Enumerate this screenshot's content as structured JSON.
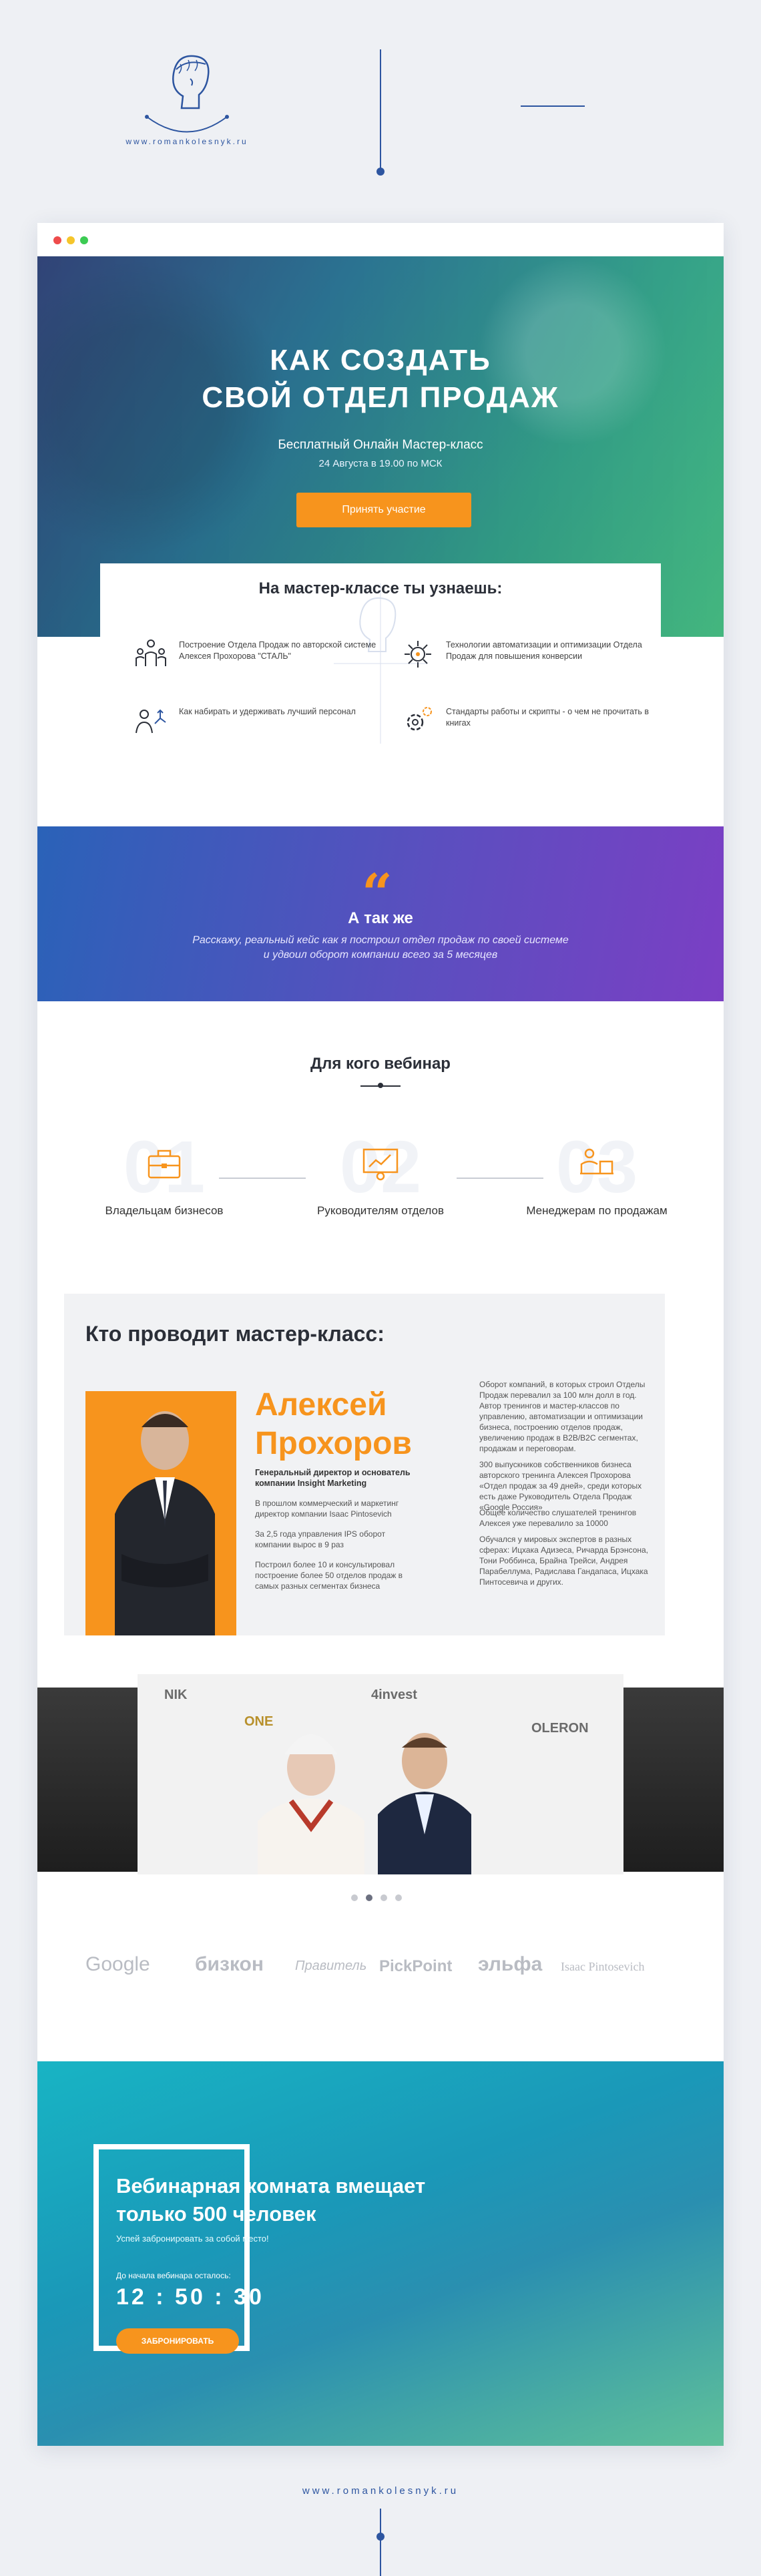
{
  "brand": {
    "url": "www.romankolesnyk.ru",
    "colors": {
      "accent": "#2d55a0",
      "orange": "#f7941d"
    }
  },
  "window": {
    "dots": [
      "#ee4b4b",
      "#f5c52b",
      "#3ccb53"
    ]
  },
  "hero": {
    "title_line1": "Как создать",
    "title_line2": "свой отдел продаж",
    "subtitle": "Бесплатный Онлайн Мастер-класс",
    "date": "24 Августа в 19.00 по МСК",
    "cta": "Принять участие"
  },
  "learn": {
    "title": "На мастер-классе ты узнаешь:",
    "items": [
      {
        "icon": "team-structure-icon",
        "text": "Построение Отдела Продаж по авторской системе Алексея Прохорова \"СТАЛЬ\""
      },
      {
        "icon": "automation-gear-icon",
        "text": "Технологии автоматизации и оптимизации Отдела Продаж для повышения конверсии"
      },
      {
        "icon": "people-growth-icon",
        "text": "Как набирать и удерживать лучший персонал"
      },
      {
        "icon": "gear-settings-icon",
        "text": "Стандарты работы и скрипты - о чем не прочитать в книгах"
      }
    ]
  },
  "quote": {
    "title": "А так же",
    "text_line1": "Расскажу, реальный кейс как я построил отдел продаж по своей системе",
    "text_line2": "и удвоил оборот компании всего за 5 месяцев"
  },
  "audience": {
    "title": "Для кого вебинар",
    "items": [
      {
        "num": "01",
        "icon": "briefcase-icon",
        "label": "Владельцам бизнесов"
      },
      {
        "num": "02",
        "icon": "manager-chart-icon",
        "label": "Руководителям отделов"
      },
      {
        "num": "03",
        "icon": "desk-worker-icon",
        "label": "Менеджерам по продажам"
      }
    ]
  },
  "speaker": {
    "title": "Кто проводит мастер-класс:",
    "name_line1": "Алексей",
    "name_line2": "Прохоров",
    "role": "Генеральный директор и основатель компании Insight Marketing",
    "bio1": "В прошлом коммерческий и маркетинг директор компании Isaac Pintosevich",
    "bio2": "За 2,5 года управления IPS оборот компании вырос в 9 раз",
    "bio3": "Построил более 10 и консультировал построение более 50 отделов продаж в самых разных сегментах бизнеса",
    "right1": "Оборот компаний, в которых строил Отделы Продаж перевалил за 100 млн долл в год. Автор тренингов и мастер-классов по управлению, автоматизации и оптимизации бизнеса, построению отделов продаж, увеличению продаж в B2B/B2C сегментах, продажам и переговорам.",
    "right2": "300 выпускников собственников бизнеса авторского тренинга Алексея Прохорова «Отдел продаж за 49 дней», среди которых есть даже Руководитель Отдела Продаж «Google Россия»",
    "right3": "Общее количество слушателей тренингов Алексея уже перевалило за 10000",
    "right4": "Обучался у мировых экспертов в разных сферах: Ицхака Адизеса, Ричарда Брэнсона, Тони Роббинса, Брайна Трейси, Андрея Парабеллума, Радислава Гандапаса, Ицхака Пинтосевича и других."
  },
  "gallery": {
    "logos": [
      "NIK",
      "4invest",
      "ONE",
      "OLERON"
    ],
    "active_slide": 2,
    "slides": 4
  },
  "partners": [
    "Google",
    "бизкон",
    "Правитель",
    "PickPoint",
    "эльфа",
    "Isaac Pintosevich"
  ],
  "room": {
    "title_line1": "Вебинарная комната вмещает",
    "title_line2": "только 500 человек",
    "subtitle": "Успей забронировать за собой место!",
    "countdown_label": "До начала вебинара осталось:",
    "countdown": "12 : 50 : 30",
    "button": "ЗАБРОНИРОВАТЬ"
  }
}
